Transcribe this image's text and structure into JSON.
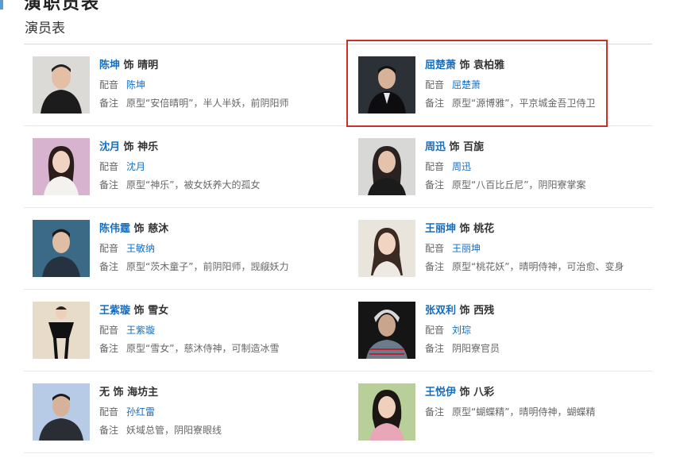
{
  "header": {
    "cut_title": "演职员表",
    "section_title": "演员表"
  },
  "cast": [
    {
      "actor": "陈坤",
      "role": "晴明",
      "voice": "陈坤",
      "note": "原型“安倍晴明”，半人半妖，前阴阳师",
      "photo_bg": "#dcdad6"
    },
    {
      "actor": "屈楚萧",
      "role": "袁柏雅",
      "voice": "屈楚萧",
      "note": "原型“源博雅”，平京城金吾卫侍卫",
      "photo_bg": "#2c3138"
    },
    {
      "actor": "沈月",
      "role": "神乐",
      "voice": "沈月",
      "note": "原型“神乐”，被女妖养大的孤女",
      "photo_bg": "#d7b3cf"
    },
    {
      "actor": "周迅",
      "role": "百旎",
      "voice": "周迅",
      "note": "原型“八百比丘尼”，阴阳寮掌案",
      "photo_bg": "#d8d8d6"
    },
    {
      "actor": "陈伟霆",
      "role": "慈沐",
      "voice": "王敏纳",
      "note": "原型“茨木童子”，前阴阳师，觊觎妖力",
      "photo_bg": "#3b6a86"
    },
    {
      "actor": "王丽坤",
      "role": "桃花",
      "voice": "王丽坤",
      "note": "原型“桃花妖”，晴明侍神，可治愈、变身",
      "photo_bg": "#e9e4dc"
    },
    {
      "actor": "王紫璇",
      "role": "雪女",
      "voice": "王紫璇",
      "note": "原型“雪女”，慈沐侍神，可制造冰雪",
      "photo_bg": "#e7dcc9"
    },
    {
      "actor": "张双利",
      "role": "西残",
      "voice": "刘琮",
      "note": "阴阳寮官员",
      "photo_bg": "#151515"
    },
    {
      "actor": "无",
      "role": "海坊主",
      "voice": "孙红雷",
      "note": "妖域总管，阴阳寮眼线",
      "photo_bg": "#b7cbe6"
    },
    {
      "actor": "王悦伊",
      "role": "八彩",
      "voice": null,
      "note": "原型“蝴蝶精”，晴明侍神，蝴蝶精",
      "photo_bg": "#b9cf9a"
    }
  ],
  "labels": {
    "as": "饰",
    "voice": "配音",
    "note": "备注"
  },
  "highlight_color": "#c9302c",
  "link_color": "#136ec2"
}
